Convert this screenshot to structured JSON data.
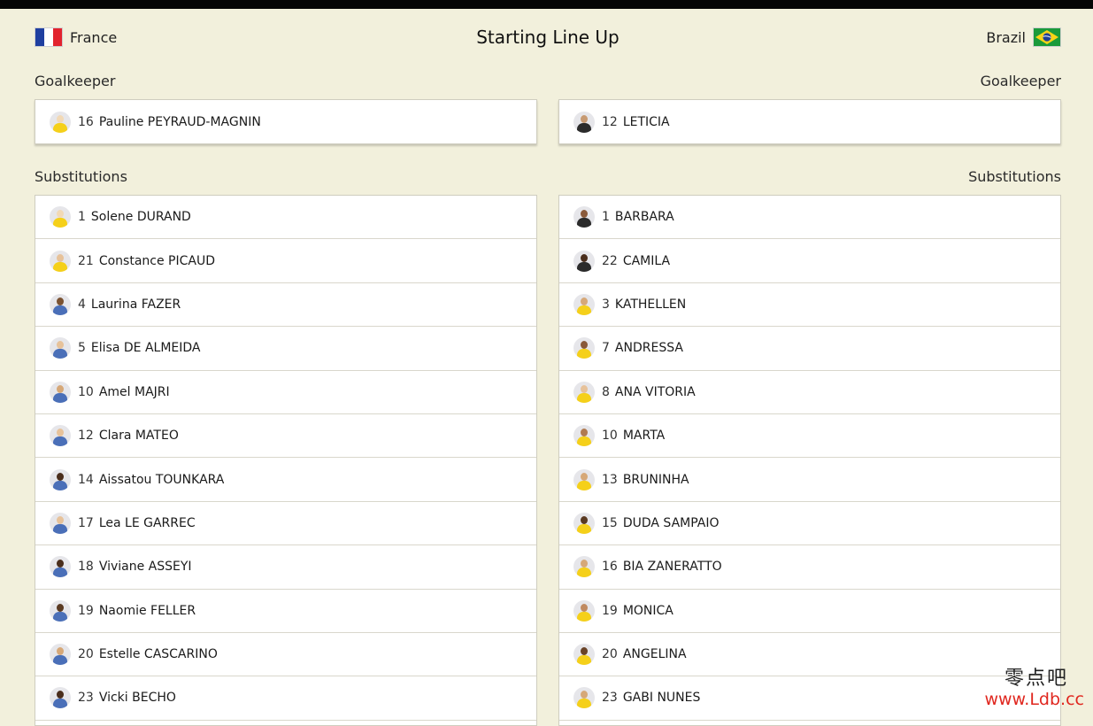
{
  "header": {
    "title": "Starting Line Up",
    "home_team": "France",
    "away_team": "Brazil"
  },
  "home": {
    "goalkeeper_label": "Goalkeeper",
    "substitutions_label": "Substitutions",
    "goalkeeper": {
      "number": "16",
      "name": "Pauline PEYRAUD-MAGNIN",
      "kit": "#f5d01a",
      "skin": "#f2d9b6"
    },
    "substitutions": [
      {
        "number": "1",
        "name": "Solene DURAND",
        "kit": "#f5d01a",
        "skin": "#f2d9b6"
      },
      {
        "number": "21",
        "name": "Constance PICAUD",
        "kit": "#f5d01a",
        "skin": "#e7c29a"
      },
      {
        "number": "4",
        "name": "Laurina FAZER",
        "kit": "#4a6fb8",
        "skin": "#7a5232"
      },
      {
        "number": "5",
        "name": "Elisa DE ALMEIDA",
        "kit": "#4a6fb8",
        "skin": "#e7c29a"
      },
      {
        "number": "10",
        "name": "Amel MAJRI",
        "kit": "#4a6fb8",
        "skin": "#d6a878"
      },
      {
        "number": "12",
        "name": "Clara MATEO",
        "kit": "#4a6fb8",
        "skin": "#e7c29a"
      },
      {
        "number": "14",
        "name": "Aissatou TOUNKARA",
        "kit": "#4a6fb8",
        "skin": "#4a2e1c"
      },
      {
        "number": "17",
        "name": "Lea LE GARREC",
        "kit": "#4a6fb8",
        "skin": "#e7c29a"
      },
      {
        "number": "18",
        "name": "Viviane ASSEYI",
        "kit": "#4a6fb8",
        "skin": "#4a2e1c"
      },
      {
        "number": "19",
        "name": "Naomie FELLER",
        "kit": "#4a6fb8",
        "skin": "#5a3a22"
      },
      {
        "number": "20",
        "name": "Estelle CASCARINO",
        "kit": "#4a6fb8",
        "skin": "#d6a878"
      },
      {
        "number": "23",
        "name": "Vicki BECHO",
        "kit": "#4a6fb8",
        "skin": "#4a2e1c"
      }
    ]
  },
  "away": {
    "goalkeeper_label": "Goalkeeper",
    "substitutions_label": "Substitutions",
    "goalkeeper": {
      "number": "12",
      "name": "LETICIA",
      "kit": "#2b2b2b",
      "skin": "#c79a72"
    },
    "substitutions": [
      {
        "number": "1",
        "name": "BARBARA",
        "kit": "#2b2b2b",
        "skin": "#8a5a3a"
      },
      {
        "number": "22",
        "name": "CAMILA",
        "kit": "#2b2b2b",
        "skin": "#4a2e1c"
      },
      {
        "number": "3",
        "name": "KATHELLEN",
        "kit": "#f5d01a",
        "skin": "#d6a878"
      },
      {
        "number": "7",
        "name": "ANDRESSA",
        "kit": "#f5d01a",
        "skin": "#8a5a3a"
      },
      {
        "number": "8",
        "name": "ANA VITORIA",
        "kit": "#f5d01a",
        "skin": "#e7c29a"
      },
      {
        "number": "10",
        "name": "MARTA",
        "kit": "#f5d01a",
        "skin": "#b07a50"
      },
      {
        "number": "13",
        "name": "BRUNINHA",
        "kit": "#f5d01a",
        "skin": "#d6a878"
      },
      {
        "number": "15",
        "name": "DUDA SAMPAIO",
        "kit": "#f5d01a",
        "skin": "#5a3a22"
      },
      {
        "number": "16",
        "name": "BIA ZANERATTO",
        "kit": "#f5d01a",
        "skin": "#d6a878"
      },
      {
        "number": "19",
        "name": "MONICA",
        "kit": "#f5d01a",
        "skin": "#c08a60"
      },
      {
        "number": "20",
        "name": "ANGELINA",
        "kit": "#f5d01a",
        "skin": "#6a4428"
      },
      {
        "number": "23",
        "name": "GABI NUNES",
        "kit": "#f5d01a",
        "skin": "#d6a878"
      }
    ]
  },
  "watermark": {
    "chinese": "零点吧",
    "url": "www.Ldb.cc"
  },
  "colors": {
    "background": "#f2f0dc",
    "card": "#ffffff",
    "border": "#cfcdbf",
    "watermark_url": "#e0271f"
  }
}
